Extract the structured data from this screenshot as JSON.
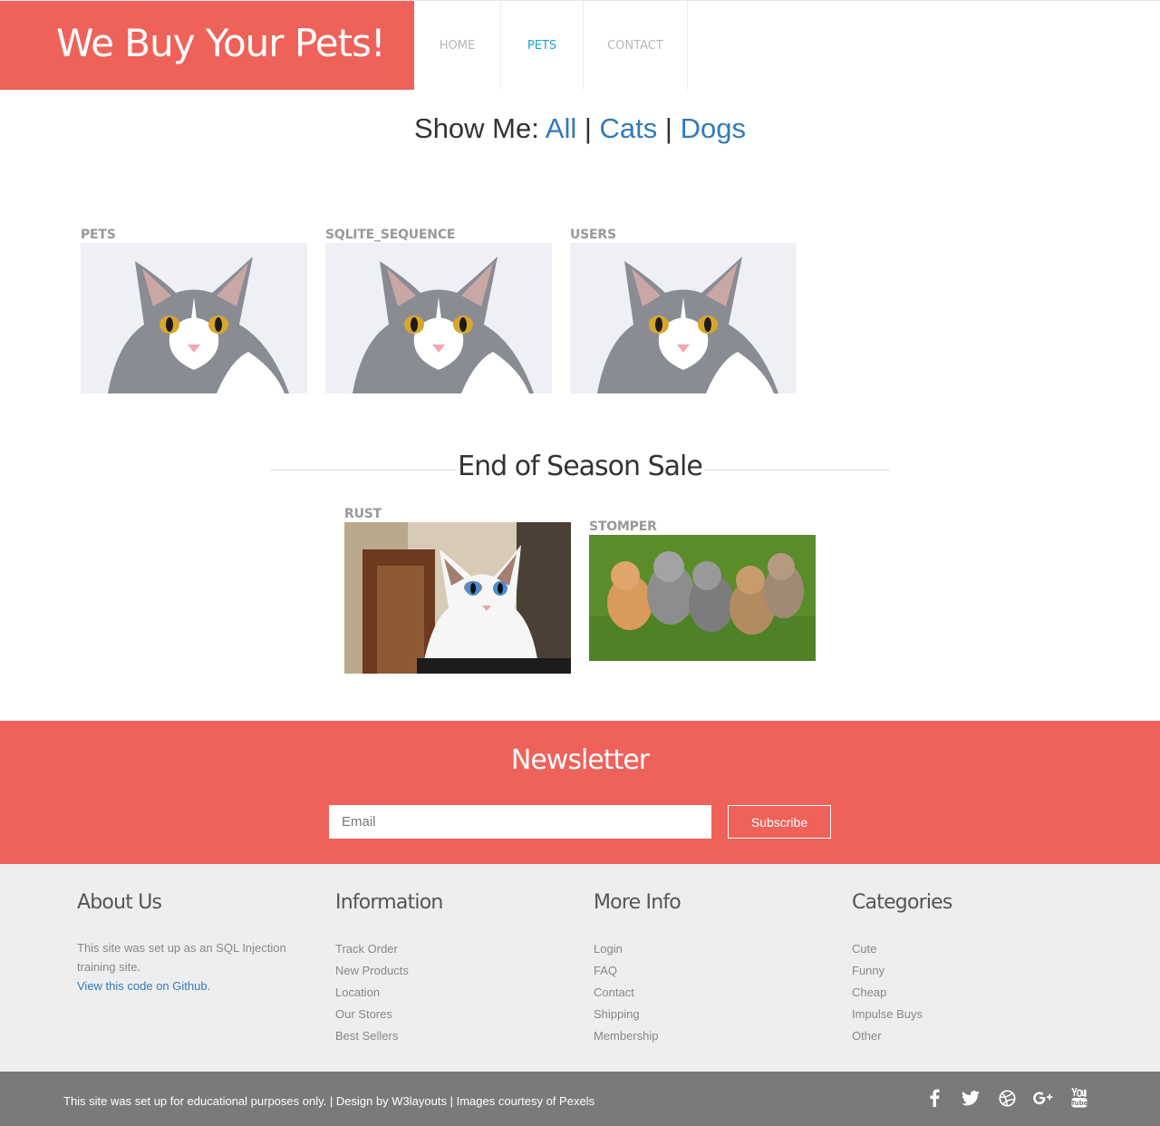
{
  "header": {
    "logo": "We Buy Your Pets!",
    "nav": [
      {
        "label": "HOME"
      },
      {
        "label": "PETS"
      },
      {
        "label": "CONTACT"
      }
    ]
  },
  "filter": {
    "prefix": "Show Me: ",
    "links": [
      "All",
      "Cats",
      "Dogs"
    ],
    "separator": "|"
  },
  "products": [
    {
      "title": "PETS"
    },
    {
      "title": "SQLITE_SEQUENCE"
    },
    {
      "title": "USERS"
    }
  ],
  "sale": {
    "heading": "End of Season Sale",
    "products": [
      {
        "title": "RUST"
      },
      {
        "title": "STOMPER"
      }
    ]
  },
  "newsletter": {
    "title": "Newsletter",
    "email_placeholder": "Email",
    "subscribe_label": "Subscribe"
  },
  "footer": {
    "about": {
      "title": "About Us",
      "text": "This site was set up as an SQL Injection training site.",
      "link": "View this code on Github."
    },
    "information": {
      "title": "Information",
      "items": [
        "Track Order",
        "New Products",
        "Location",
        "Our Stores",
        "Best Sellers"
      ]
    },
    "more_info": {
      "title": "More Info",
      "items": [
        "Login",
        "FAQ",
        "Contact",
        "Shipping",
        "Membership"
      ]
    },
    "categories": {
      "title": "Categories",
      "items": [
        "Cute",
        "Funny",
        "Cheap",
        "Impulse Buys",
        "Other"
      ]
    }
  },
  "bottom": {
    "text1": "This site was set up for educational purposes only.",
    "sep": " | ",
    "design_prefix": "Design by ",
    "design_link": "W3layouts",
    "images_prefix": "Images courtesy of ",
    "images_link": "Pexels",
    "social": [
      "facebook-icon",
      "twitter-icon",
      "dribbble-icon",
      "google-plus-icon",
      "youtube-icon"
    ]
  },
  "colors": {
    "brand": "#ee625a",
    "active_nav": "#1aa3c9",
    "link": "#337ab7",
    "footer_bg": "#eeeeee",
    "bottombar_bg": "#7a7a7a"
  }
}
